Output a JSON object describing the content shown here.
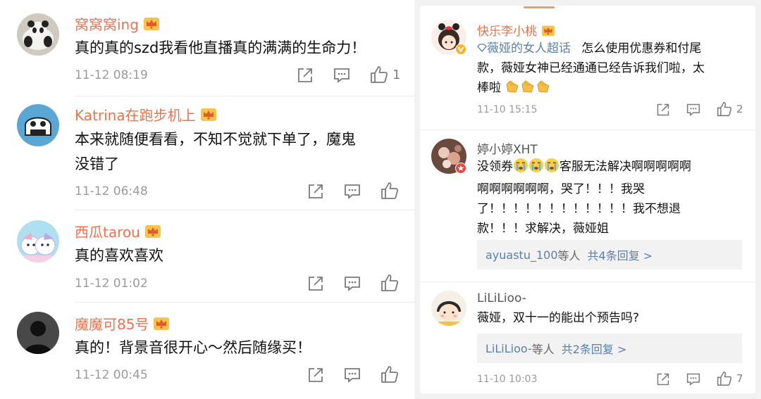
{
  "left_comments": [
    {
      "user": "窝窝窝ing",
      "text": "真的真的szd我看他直播真的满满的生命力！",
      "time": "11-12 08:19",
      "likes": "1"
    },
    {
      "user": "Katrina在跑步机上",
      "text_lines": [
        "本来就随便看看，不知不觉就下单了，魔鬼",
        "没错了"
      ],
      "time": "11-12 06:48",
      "likes": ""
    },
    {
      "user": "西瓜tarou",
      "text": "真的喜欢喜欢",
      "time": "11-12 01:02",
      "likes": ""
    },
    {
      "user": "魔魔可85号",
      "text": "真的！背景音很开心～然后随缘买！",
      "time": "11-12 00:45",
      "likes": ""
    }
  ],
  "right_comments": [
    {
      "user": "快乐李小桃",
      "topic": "薇娅的女人超话",
      "text_line1": "怎么使用优惠券和付尾",
      "text_line2": "款，薇娅女神已经通通已经告诉我们啦，太",
      "text_line3": "棒啦",
      "time": "11-10 15:15",
      "likes": "2"
    },
    {
      "user": "婷小婷XHT",
      "text_line1_a": "没领券",
      "text_line1_b": "客服无法解决啊啊啊啊啊",
      "text_line2": "啊啊啊啊啊啊，哭了！！！我哭",
      "text_line3": "了！！！！！！！！！！！！我不想退",
      "text_line4": "款！！！求解决，薇娅姐",
      "reply_who": "ayuastu_100",
      "reply_mid": "等人",
      "reply_more": "共4条回复 >"
    },
    {
      "user": "LiLiLioo-",
      "text": "薇娅，双十一的能出个预告吗?",
      "reply_who": "LiLiLioo-",
      "reply_mid": "等人",
      "reply_more": "共2条回复 >",
      "time": "11-10 10:03",
      "likes": "7"
    }
  ],
  "icons": {
    "share": "share-icon",
    "comment": "comment-icon",
    "like": "thumbs-up-icon",
    "crown": "vip-crown-icon",
    "emoji_clap": "clap-emoji-icon",
    "emoji_cry": "crying-emoji-icon"
  },
  "colors": {
    "username": "#eb7350",
    "link": "#5a7fab",
    "time": "#9a9a9a",
    "reply_bg": "#f2f2f2",
    "accent": "#f39a5d"
  }
}
